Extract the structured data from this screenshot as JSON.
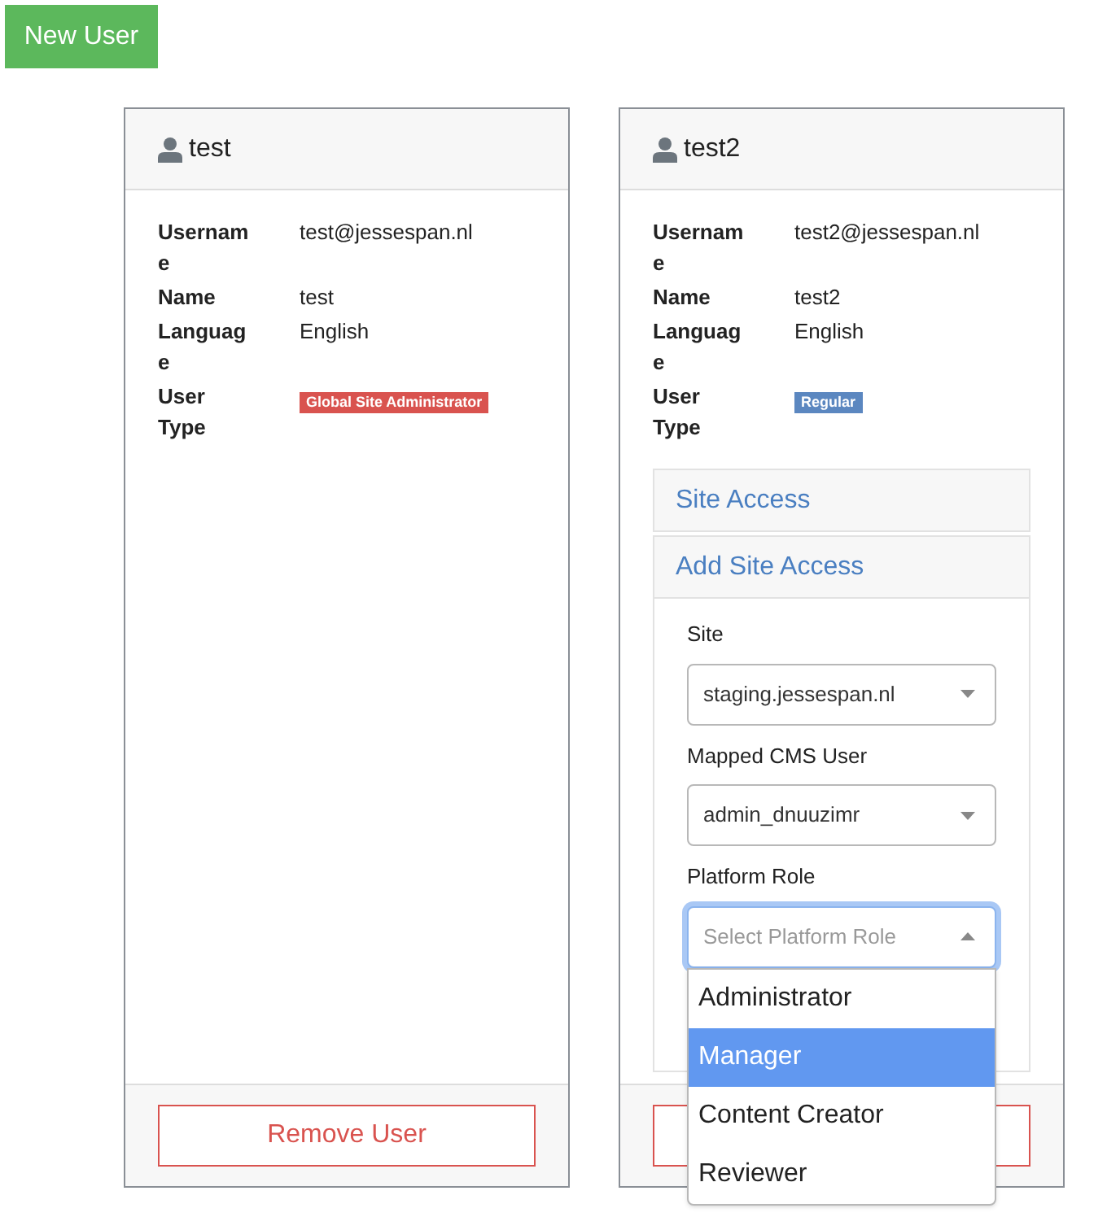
{
  "new_user_button": "New User",
  "users": [
    {
      "name": "test",
      "fields": [
        {
          "label": "Username",
          "value": "test@jessespan.nl"
        },
        {
          "label": "Name",
          "value": "test"
        },
        {
          "label": "Language",
          "value": "English"
        },
        {
          "label": "User Type",
          "badge": "Global Site Administrator",
          "color": "#d9534f"
        }
      ],
      "remove_button": {
        "label": "Remove User"
      }
    },
    {
      "name": "test2",
      "fields": [
        {
          "label": "Username",
          "value": "test2@jessespan.nl"
        },
        {
          "label": "Name",
          "value": "test2"
        },
        {
          "label": "Language",
          "value": "English"
        },
        {
          "label": "User Type",
          "badge": "Regular",
          "color": "#5b87c0"
        }
      ],
      "site_access": {
        "panels": [
          "Site Access",
          "Add Site Access"
        ],
        "form": [
          {
            "label": "Site",
            "value": "staging.jessespan.nl"
          },
          {
            "label": "Mapped CMS User",
            "value": "admin_dnuuzimr"
          },
          {
            "label": "Platform Role",
            "placeholder": "Select Platform Role",
            "expanded": true,
            "options": [
              {
                "label": "Administrator",
                "selected": false
              },
              {
                "label": "Manager",
                "selected": true
              },
              {
                "label": "Content Creator",
                "selected": false
              },
              {
                "label": "Reviewer",
                "selected": false
              }
            ]
          }
        ]
      }
    }
  ]
}
